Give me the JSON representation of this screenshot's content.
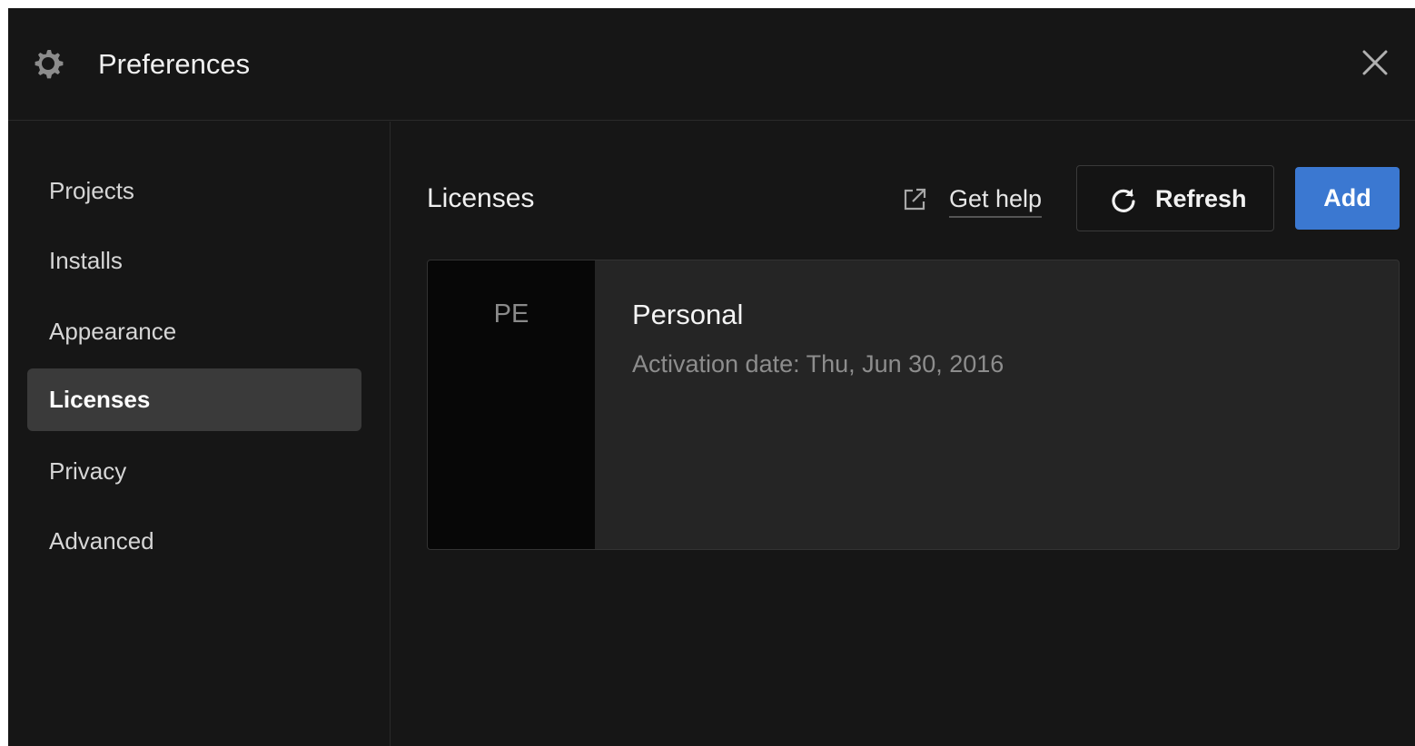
{
  "window": {
    "title": "Preferences",
    "icons": {
      "settings": "gear-icon",
      "close": "close-icon"
    }
  },
  "sidebar": {
    "items": [
      {
        "label": "Projects",
        "active": false
      },
      {
        "label": "Installs",
        "active": false
      },
      {
        "label": "Appearance",
        "active": false
      },
      {
        "label": "Licenses",
        "active": true
      },
      {
        "label": "Privacy",
        "active": false
      },
      {
        "label": "Advanced",
        "active": false
      }
    ]
  },
  "main": {
    "title": "Licenses",
    "help_link": {
      "label": "Get help",
      "icon": "external-link-icon"
    },
    "refresh_button": {
      "label": "Refresh",
      "icon": "refresh-icon"
    },
    "add_button": {
      "label": "Add"
    },
    "license": {
      "badge": "PE",
      "name": "Personal",
      "activation": "Activation date: Thu, Jun 30, 2016"
    }
  },
  "colors": {
    "background": "#161616",
    "accent": "#3b78d1",
    "active_nav": "#3a3a3a",
    "card": "#252525",
    "badge": "#070707"
  }
}
